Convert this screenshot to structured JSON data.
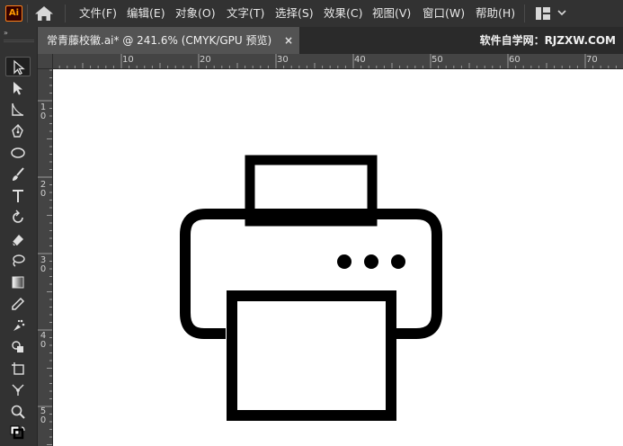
{
  "app": {
    "logo_text": "Ai",
    "logo_color": "#ff9a00",
    "home_icon": "home-icon",
    "workspace_icon": "workspace-layout-icon"
  },
  "menu": {
    "items": [
      "文件(F)",
      "编辑(E)",
      "对象(O)",
      "文字(T)",
      "选择(S)",
      "效果(C)",
      "视图(V)",
      "窗口(W)",
      "帮助(H)"
    ]
  },
  "document": {
    "tab_label": "常青藤校徽.ai* @ 241.6% (CMYK/GPU 预览)",
    "close_label": "×",
    "watermark": "软件自学网：RJZXW.COM"
  },
  "toolbar": {
    "collapse_label": "»",
    "tools": [
      "selection-tool",
      "direct-selection-tool",
      "curvature-tool",
      "pen-tool",
      "ellipse-tool",
      "paintbrush-tool",
      "type-tool",
      "rotate-tool",
      "eraser-tool",
      "lasso-tool",
      "gradient-tool",
      "eyedropper-tool",
      "symbol-sprayer-tool",
      "shape-builder-tool",
      "artboard-tool",
      "puppet-warp-tool",
      "zoom-tool",
      "fill-stroke-swap"
    ]
  },
  "rulers": {
    "horizontal_labels": [
      "10",
      "20",
      "30",
      "40",
      "50",
      "60",
      "70"
    ],
    "vertical_labels": [
      "10",
      "20",
      "30",
      "40",
      "50"
    ]
  },
  "canvas": {
    "background": "#ffffff",
    "artwork": "printer-icon",
    "artwork_color": "#000000"
  }
}
